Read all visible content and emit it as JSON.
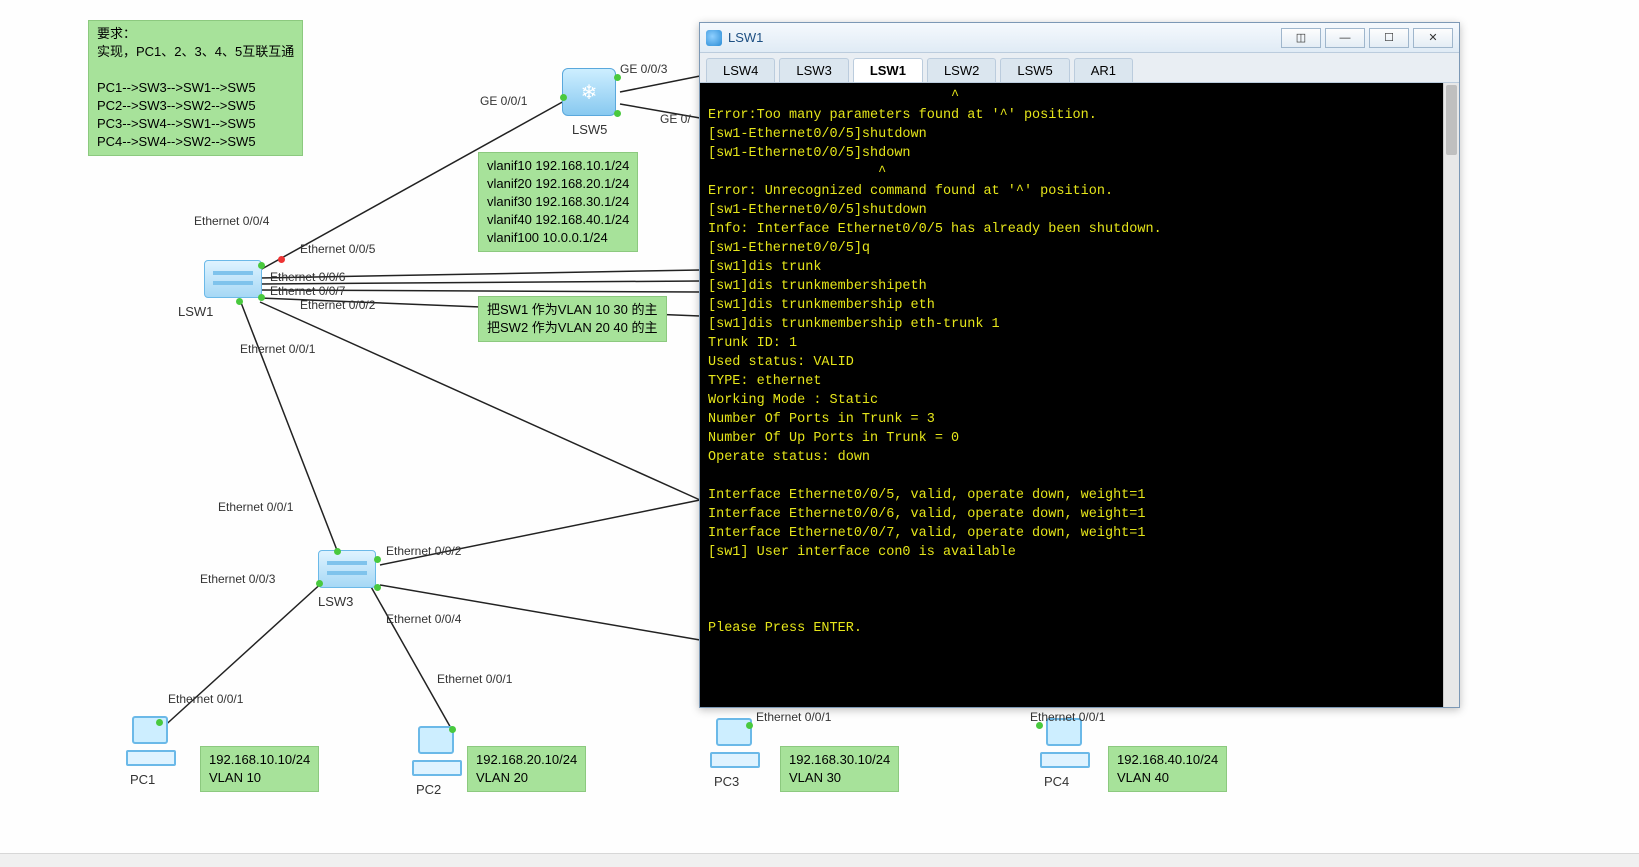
{
  "requirements_box": "要求：\n实现，PC1、2、3、4、5互联互通\n\nPC1-->SW3-->SW1-->SW5\nPC2-->SW3-->SW2-->SW5\nPC3-->SW4-->SW1-->SW5\nPC4-->SW4-->SW2-->SW5",
  "vlanif_box": "vlanif10 192.168.10.1/24\nvlanif20 192.168.20.1/24\nvlanif30 192.168.30.1/24\nvlanif40 192.168.40.1/24\nvlanif100 10.0.0.1/24",
  "vlan_role_box": "把SW1 作为VLAN 10 30 的主\n把SW2 作为VLAN 20 40 的主",
  "devices": {
    "lsw1": "LSW1",
    "lsw3": "LSW3",
    "lsw5": "LSW5",
    "pc1": "PC1",
    "pc2": "PC2",
    "pc3": "PC3",
    "pc4": "PC4"
  },
  "pc_info": {
    "pc1": "192.168.10.10/24\nVLAN 10",
    "pc2": "192.168.20.10/24\nVLAN 20",
    "pc3": "192.168.30.10/24\nVLAN 30",
    "pc4": "192.168.40.10/24\nVLAN 40"
  },
  "port_labels": {
    "ge003": "GE 0/0/3",
    "ge001": "GE 0/0/1",
    "ge0": "GE 0/",
    "eth004": "Ethernet 0/0/4",
    "eth005": "Ethernet 0/0/5",
    "eth006": "Ethernet 0/0/6",
    "eth007": "Ethernet 0/0/7",
    "eth002_lsw1": "Ethernet 0/0/2",
    "eth001_lsw1": "Ethernet 0/0/1",
    "eth001_lsw3top": "Ethernet 0/0/1",
    "eth002_lsw3": "Ethernet 0/0/2",
    "eth003_lsw3": "Ethernet 0/0/3",
    "eth004_lsw3": "Ethernet 0/0/4",
    "eth001_pc1": "Ethernet 0/0/1",
    "eth001_pc2": "Ethernet 0/0/1",
    "eth001_pc3": "Ethernet 0/0/1",
    "eth001_pc4": "Ethernet 0/0/1"
  },
  "terminal": {
    "title": "LSW1",
    "tabs": [
      "LSW4",
      "LSW3",
      "LSW1",
      "LSW2",
      "LSW5",
      "AR1"
    ],
    "active_tab_index": 2,
    "content": "                              ^\nError:Too many parameters found at '^' position.\n[sw1-Ethernet0/0/5]shutdown\n[sw1-Ethernet0/0/5]shdown\n                     ^\nError: Unrecognized command found at '^' position.\n[sw1-Ethernet0/0/5]shutdown\nInfo: Interface Ethernet0/0/5 has already been shutdown.\n[sw1-Ethernet0/0/5]q\n[sw1]dis trunk\n[sw1]dis trunkmembershipeth\n[sw1]dis trunkmembership eth\n[sw1]dis trunkmembership eth-trunk 1\nTrunk ID: 1\nUsed status: VALID\nTYPE: ethernet\nWorking Mode : Static\nNumber Of Ports in Trunk = 3\nNumber Of Up Ports in Trunk = 0\nOperate status: down\n\nInterface Ethernet0/0/5, valid, operate down, weight=1\nInterface Ethernet0/0/6, valid, operate down, weight=1\nInterface Ethernet0/0/7, valid, operate down, weight=1\n[sw1] User interface con0 is available\n\n\n\nPlease Press ENTER."
  },
  "window_controls": {
    "pin": "◫",
    "min": "—",
    "max": "☐",
    "close": "✕"
  }
}
